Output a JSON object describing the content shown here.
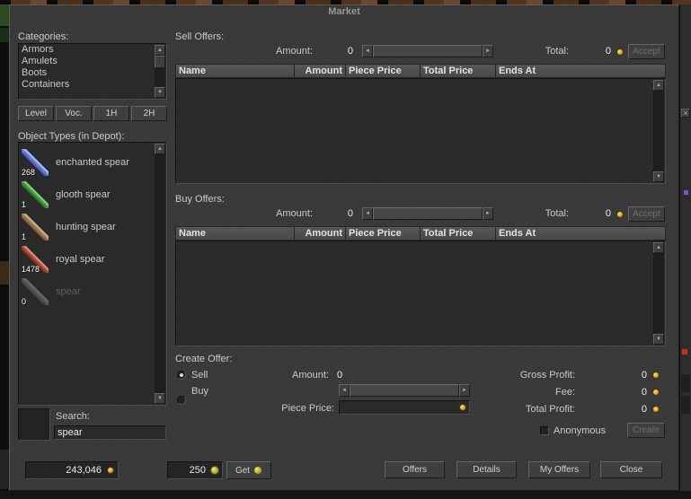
{
  "window": {
    "title": "Market"
  },
  "icons": {
    "close": "×",
    "up_arrow": "▲",
    "down_arrow": "▼",
    "left_arrow": "◄",
    "right_arrow": "►"
  },
  "left_panel": {
    "categories_label": "Categories:",
    "categories": [
      "Armors",
      "Amulets",
      "Boots",
      "Containers"
    ],
    "filter_buttons": [
      "Level",
      "Voc.",
      "1H",
      "2H"
    ],
    "object_types_label": "Object Types (in Depot):",
    "objects": [
      {
        "name": "enchanted spear",
        "count": "268"
      },
      {
        "name": "glooth spear",
        "count": "1"
      },
      {
        "name": "hunting spear",
        "count": "1"
      },
      {
        "name": "royal spear",
        "count": "1478"
      },
      {
        "name": "spear",
        "count": "0"
      }
    ],
    "search_label": "Search:",
    "search_value": "spear"
  },
  "sell_offers": {
    "title": "Sell Offers:",
    "amount_label": "Amount:",
    "amount_value": "0",
    "total_label": "Total:",
    "total_value": "0",
    "accept_label": "Accept",
    "columns": [
      "Name",
      "Amount",
      "Piece Price",
      "Total Price",
      "Ends At"
    ]
  },
  "buy_offers": {
    "title": "Buy Offers:",
    "amount_label": "Amount:",
    "amount_value": "0",
    "total_label": "Total:",
    "total_value": "0",
    "accept_label": "Accept",
    "columns": [
      "Name",
      "Amount",
      "Piece Price",
      "Total Price",
      "Ends At"
    ]
  },
  "create_offer": {
    "title": "Create Offer:",
    "sell_radio_label": "Sell",
    "buy_radio_label": "Buy",
    "amount_label": "Amount:",
    "amount_value": "0",
    "piece_price_label": "Piece Price:",
    "piece_price_value": "",
    "gross_profit_label": "Gross Profit:",
    "gross_profit_value": "0",
    "fee_label": "Fee:",
    "fee_value": "0",
    "total_profit_label": "Total Profit:",
    "total_profit_value": "0",
    "anonymous_label": "Anonymous",
    "create_button_label": "Create"
  },
  "footer": {
    "gold_balance": "243,046",
    "tibia_coins": "250",
    "get_button_label": "Get",
    "offers_label": "Offers",
    "details_label": "Details",
    "my_offers_label": "My Offers",
    "close_label": "Close"
  },
  "colors": {
    "window_bg": "#3b3b3b",
    "panel_bg": "#2a2a2a",
    "gold_coin": "#dba21e",
    "tibia_coin": "#a8b52a",
    "enchanted_spear_icon": "#6a7ae0",
    "glooth_spear_icon": "#3f9c3f",
    "hunting_spear_icon": "#a07848",
    "royal_spear_icon": "#b04838",
    "spear_icon": "#8a8a8a"
  }
}
